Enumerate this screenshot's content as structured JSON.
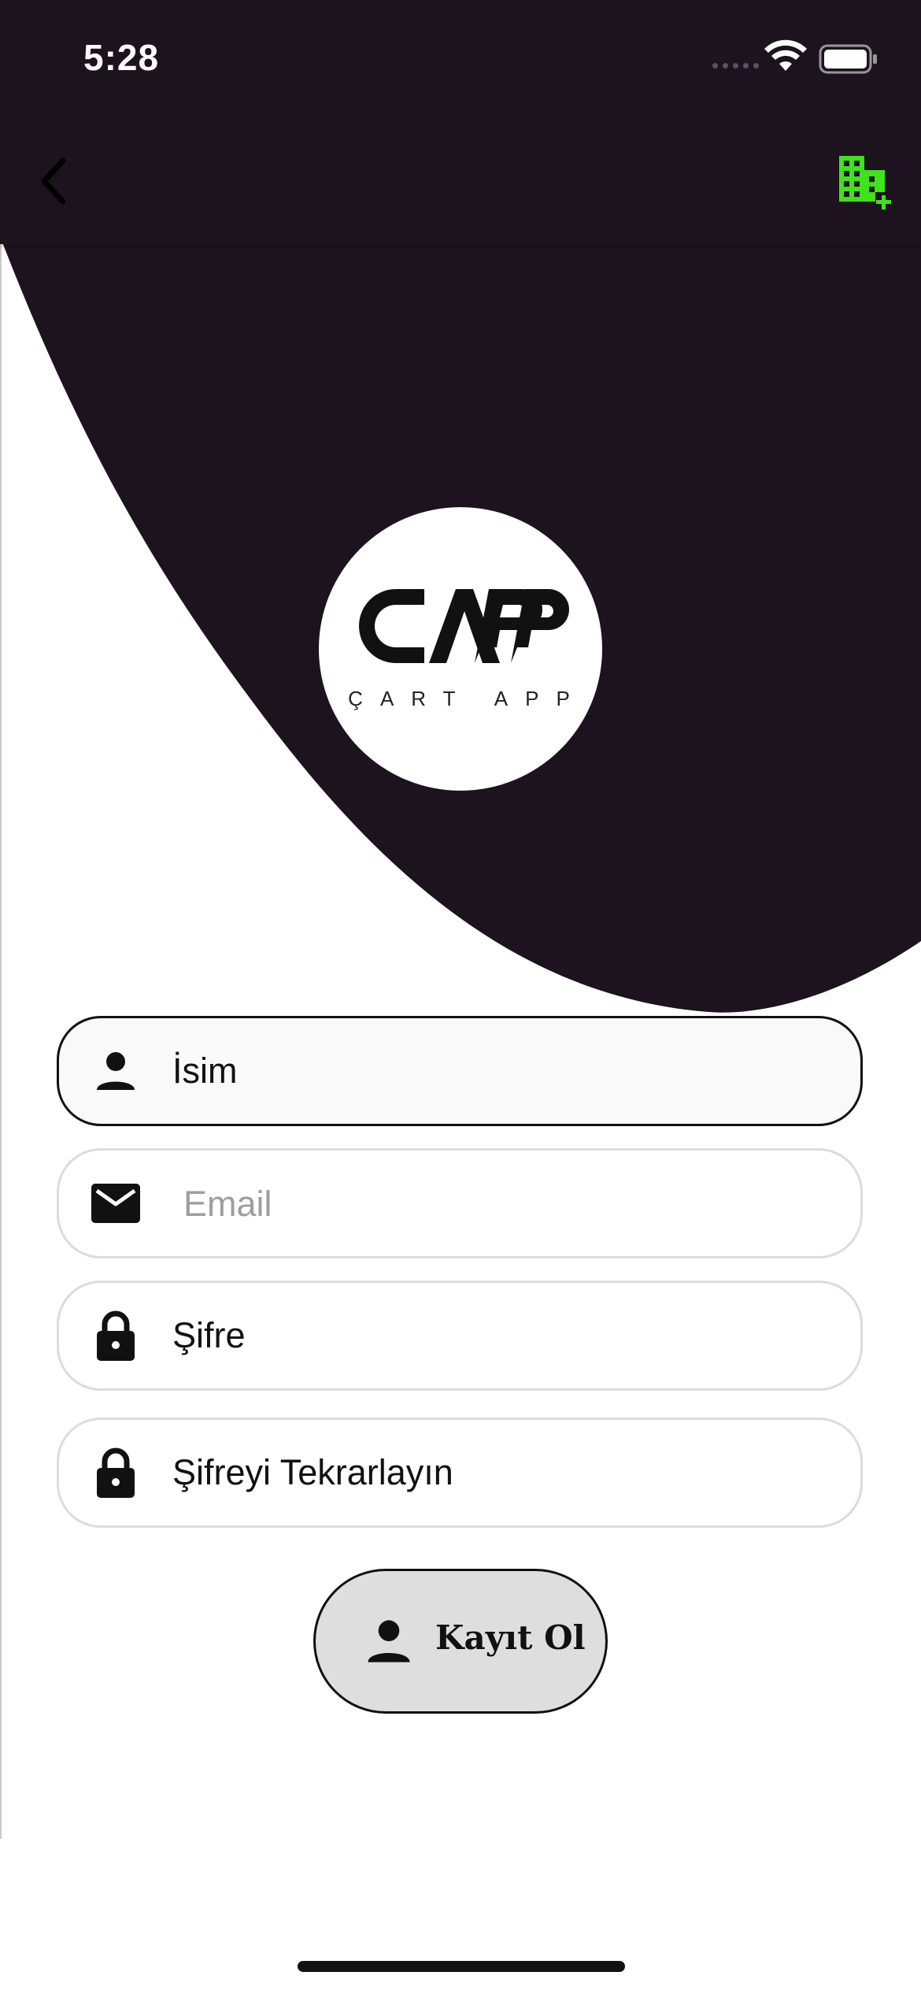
{
  "status_bar": {
    "time": "5:28"
  },
  "nav": {
    "back_icon": "chevron-left-icon",
    "action_icon": "building-add-icon",
    "action_color": "#3fe21c"
  },
  "logo": {
    "wordmark": "CAPP",
    "tagline": "ÇART APP"
  },
  "form": {
    "name": {
      "value": "İsim",
      "icon": "person-icon"
    },
    "email": {
      "placeholder": "Email",
      "icon": "mail-icon"
    },
    "password": {
      "value": "Şifre",
      "icon": "lock-icon"
    },
    "password_repeat": {
      "value": "Şifreyi Tekrarlayın",
      "icon": "lock-icon"
    }
  },
  "submit": {
    "label": "Kayıt Ol",
    "icon": "person-icon"
  },
  "colors": {
    "dark": "#1c131e",
    "accent": "#3fe21c"
  }
}
